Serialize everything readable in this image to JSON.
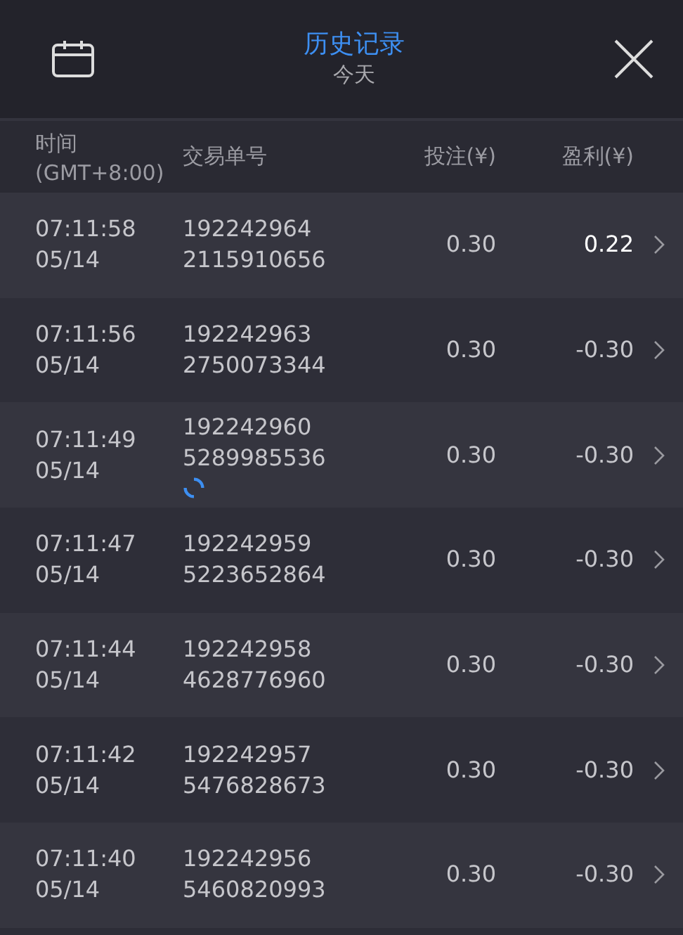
{
  "header": {
    "title": "历史记录",
    "subtitle": "今天"
  },
  "columns": [
    {
      "label": "时间",
      "sublabel": "(GMT+8:00)"
    },
    {
      "label": "交易单号"
    },
    {
      "label": "投注(¥)"
    },
    {
      "label": "盈利(¥)"
    }
  ],
  "rows": [
    {
      "time": "07:11:58",
      "date": "05/14",
      "order": "192242964",
      "order_2": "2115910656",
      "stake": "0.30",
      "profit": "0.22",
      "win": true,
      "loading": false
    },
    {
      "time": "07:11:56",
      "date": "05/14",
      "order": "192242963",
      "order_2": "2750073344",
      "stake": "0.30",
      "profit": "-0.30",
      "win": false,
      "loading": false
    },
    {
      "time": "07:11:49",
      "date": "05/14",
      "order": "192242960",
      "order_2": "5289985536",
      "stake": "0.30",
      "profit": "-0.30",
      "win": false,
      "loading": true
    },
    {
      "time": "07:11:47",
      "date": "05/14",
      "order": "192242959",
      "order_2": "5223652864",
      "stake": "0.30",
      "profit": "-0.30",
      "win": false,
      "loading": false
    },
    {
      "time": "07:11:44",
      "date": "05/14",
      "order": "192242958",
      "order_2": "4628776960",
      "stake": "0.30",
      "profit": "-0.30",
      "win": false,
      "loading": false
    },
    {
      "time": "07:11:42",
      "date": "05/14",
      "order": "192242957",
      "order_2": "5476828673",
      "stake": "0.30",
      "profit": "-0.30",
      "win": false,
      "loading": false
    },
    {
      "time": "07:11:40",
      "date": "05/14",
      "order": "192242956",
      "order_2": "5460820993",
      "stake": "0.30",
      "profit": "-0.30",
      "win": false,
      "loading": false
    }
  ]
}
